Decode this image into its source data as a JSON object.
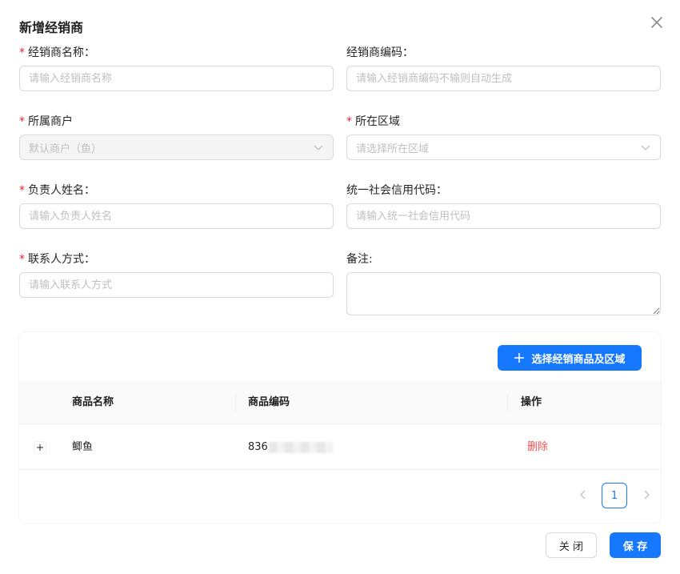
{
  "dialog": {
    "title": "新增经销商"
  },
  "form": {
    "required_mark": "*",
    "dealer_name": {
      "label": "经销商名称：",
      "placeholder": "请输入经销商名称"
    },
    "dealer_code": {
      "label": "经销商编码：",
      "placeholder": "请输入经销商编码不输则自动生成"
    },
    "merchant": {
      "label": "所属商户",
      "value": "默认商户（鱼）"
    },
    "region": {
      "label": "所在区域",
      "placeholder": "请选择所在区域"
    },
    "manager_name": {
      "label": "负责人姓名：",
      "placeholder": "请输入负责人姓名"
    },
    "credit_code": {
      "label": "统一社会信用代码：",
      "placeholder": "请输入统一社会信用代码"
    },
    "contact": {
      "label": "联系人方式：",
      "placeholder": "请输入联系人方式"
    },
    "remark": {
      "label": "备注:"
    }
  },
  "products": {
    "add_button_label": "选择经销商品及区域",
    "columns": [
      "商品名称",
      "商品编码",
      "操作"
    ],
    "rows": [
      {
        "name": "鲫鱼",
        "code": "836",
        "action": "删除"
      }
    ],
    "pagination": {
      "current_page": "1"
    }
  },
  "footer": {
    "close_label": "关 闭",
    "save_label": "保 存"
  },
  "colors": {
    "primary": "#1677ff",
    "danger": "#ff4d4f",
    "required": "#f5222d"
  }
}
